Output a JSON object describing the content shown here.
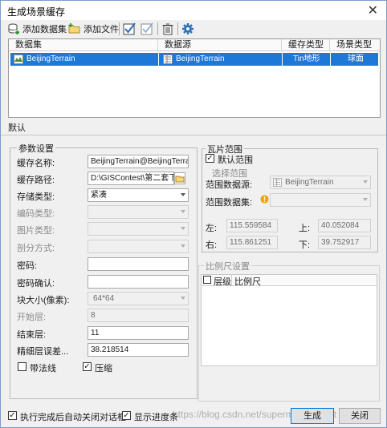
{
  "window": {
    "title": "生成场景缓存",
    "close_glyph": "✕"
  },
  "toolbar": {
    "add_dataset": "添加数据集",
    "add_file": "添加文件"
  },
  "grid": {
    "columns": [
      "数据集",
      "数据源",
      "缓存类型",
      "场景类型"
    ],
    "rows": [
      {
        "dataset": "BeijingTerrain",
        "datasource": "BeijingTerrain",
        "cache_type": "Tin地形",
        "scene_type": "球面"
      }
    ]
  },
  "tab": {
    "label": "默认"
  },
  "params": {
    "group_title": "参数设置",
    "cache_name_label": "缓存名称:",
    "cache_name": "BeijingTerrain@BeijingTerrain",
    "cache_path_label": "缓存路径:",
    "cache_path": "D:\\GISContest\\第二套下午",
    "storage_type_label": "存储类型:",
    "storage_type": "紧凑",
    "encode_type_label": "编码类型:",
    "image_type_label": "图片类型:",
    "split_label": "剖分方式:",
    "password_label": "密码:",
    "password_confirm_label": "密码确认:",
    "tile_size_label": "块大小(像素):",
    "tile_size": "64*64",
    "start_level_label": "开始层:",
    "start_level": "8",
    "end_level_label": "结束层:",
    "end_level": "11",
    "fine_error_label": "精细层误差...",
    "fine_error": "38.218514",
    "normal_label": "带法线",
    "normal_checked": false,
    "compress_label": "压缩",
    "compress_checked": true
  },
  "tile_range": {
    "group_title": "瓦片范围",
    "default_range_label": "默认范围",
    "default_checked": true,
    "select_range_label": "选择范围",
    "range_datasource_label": "范围数据源:",
    "range_datasource": "BeijingTerrain",
    "range_dataset_label": "范围数据集:",
    "left_label": "左:",
    "left": "115.559584",
    "top_label": "上:",
    "top": "40.052084",
    "right_label": "右:",
    "right": "115.861251",
    "bottom_label": "下:",
    "bottom": "39.752917"
  },
  "scale": {
    "group_title": "比例尺设置",
    "col_level": "层级",
    "col_scale": "比例尺"
  },
  "footer": {
    "auto_close_label": "执行完成后自动关闭对话框",
    "auto_close_checked": true,
    "show_progress_label": "显示进度条",
    "show_progress_checked": true,
    "watermark": "https://blog.csdn.net/supermapsupport",
    "generate_button": "生成",
    "close_button": "关闭"
  },
  "colors": {
    "selection": "#1e78d7",
    "accent_icon": "#2b6fb5",
    "warning": "#f0a000"
  }
}
